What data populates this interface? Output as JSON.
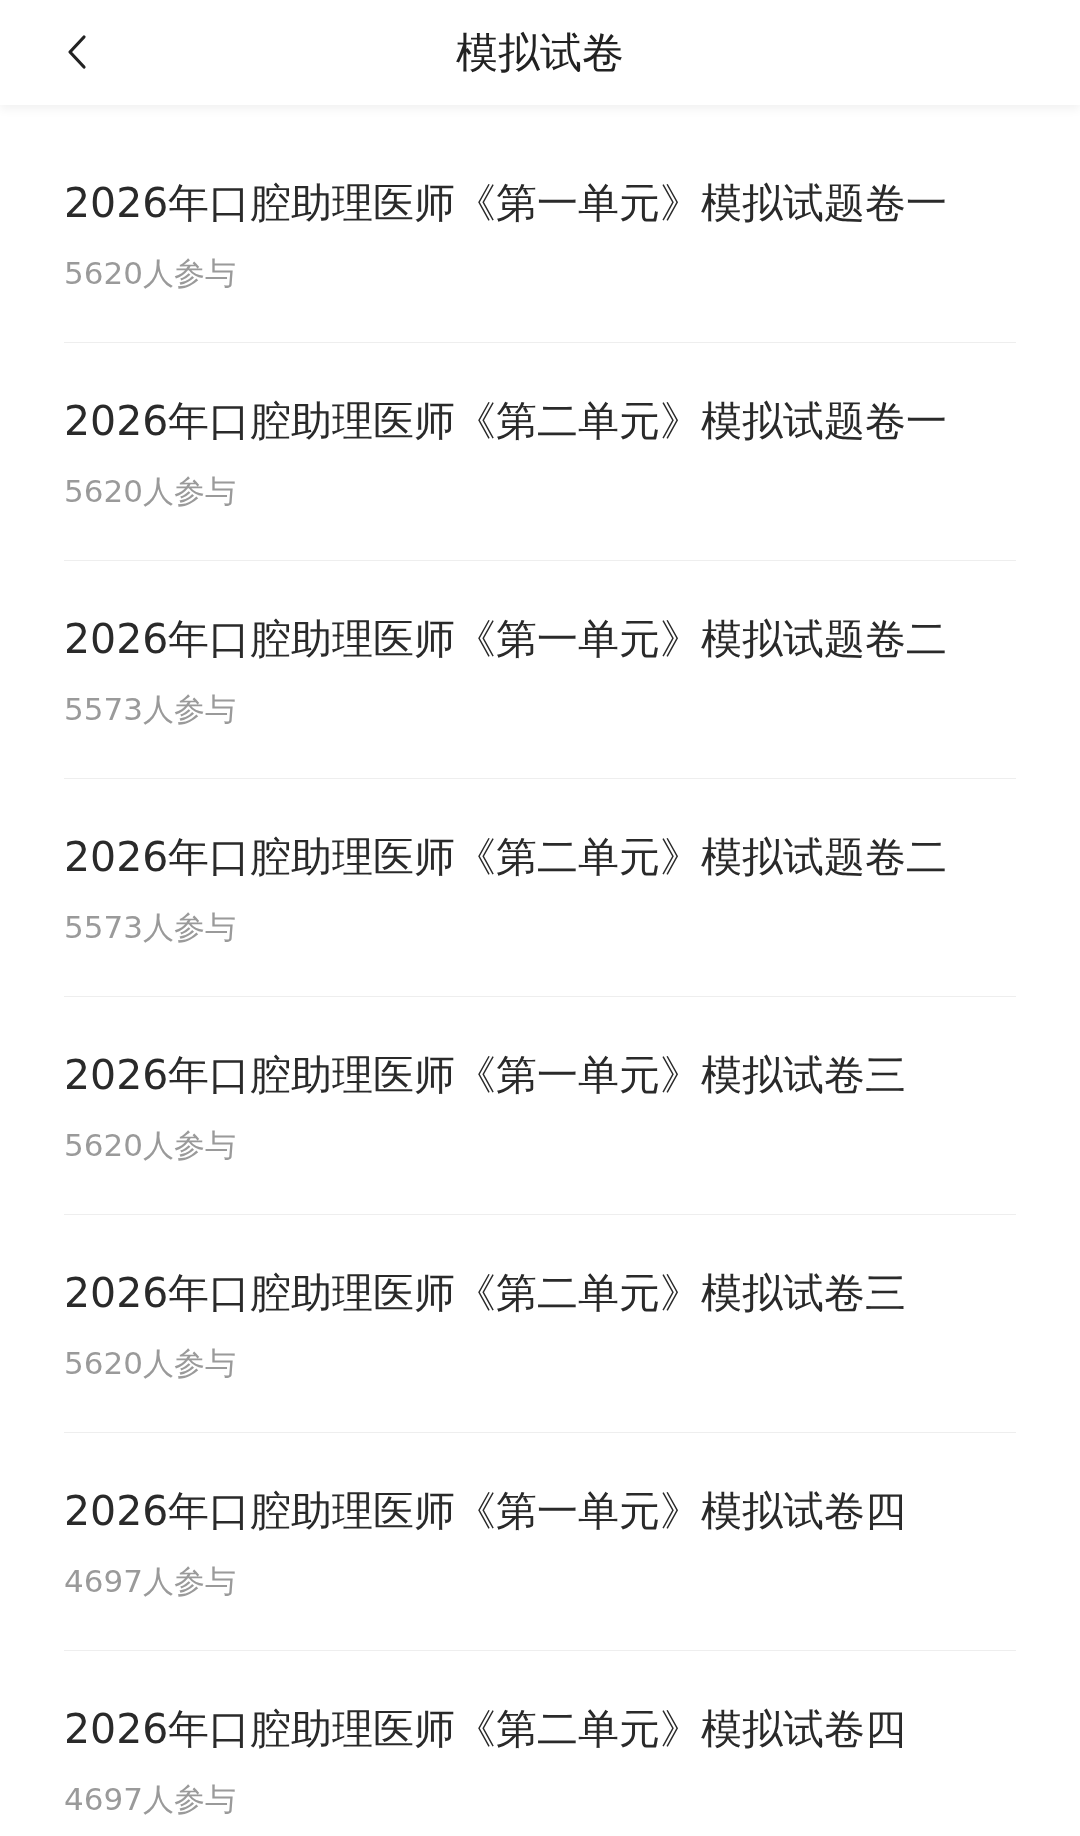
{
  "header": {
    "title": "模拟试卷"
  },
  "papers": [
    {
      "title": "2026年口腔助理医师《第一单元》模拟试题卷一",
      "participants": "5620人参与"
    },
    {
      "title": "2026年口腔助理医师《第二单元》模拟试题卷一",
      "participants": "5620人参与"
    },
    {
      "title": "2026年口腔助理医师《第一单元》模拟试题卷二",
      "participants": "5573人参与"
    },
    {
      "title": "2026年口腔助理医师《第二单元》模拟试题卷二",
      "participants": "5573人参与"
    },
    {
      "title": "2026年口腔助理医师《第一单元》模拟试卷三",
      "participants": "5620人参与"
    },
    {
      "title": "2026年口腔助理医师《第二单元》模拟试卷三",
      "participants": "5620人参与"
    },
    {
      "title": "2026年口腔助理医师《第一单元》模拟试卷四",
      "participants": "4697人参与"
    },
    {
      "title": "2026年口腔助理医师《第二单元》模拟试卷四",
      "participants": "4697人参与"
    }
  ]
}
